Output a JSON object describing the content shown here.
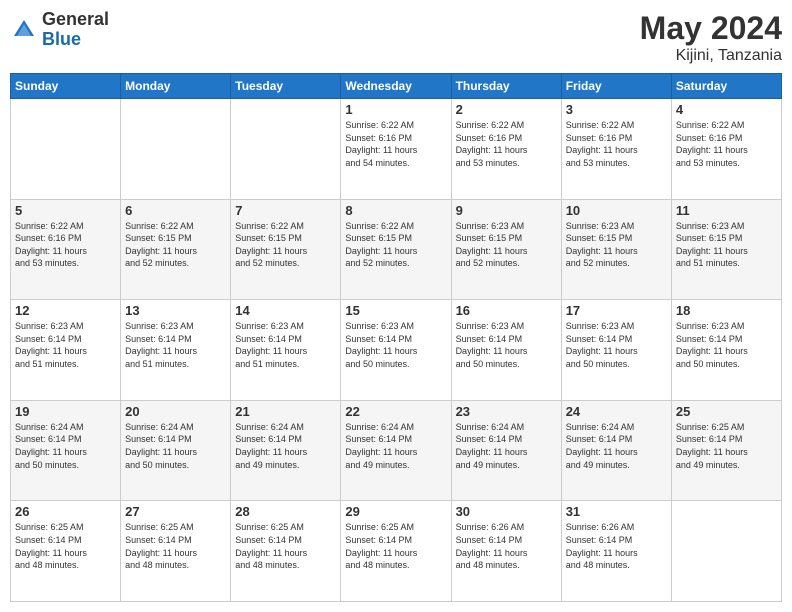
{
  "header": {
    "logo": {
      "general": "General",
      "blue": "Blue"
    },
    "title": "May 2024",
    "subtitle": "Kijini, Tanzania"
  },
  "days_of_week": [
    "Sunday",
    "Monday",
    "Tuesday",
    "Wednesday",
    "Thursday",
    "Friday",
    "Saturday"
  ],
  "weeks": [
    [
      {
        "day": "",
        "info": ""
      },
      {
        "day": "",
        "info": ""
      },
      {
        "day": "",
        "info": ""
      },
      {
        "day": "1",
        "info": "Sunrise: 6:22 AM\nSunset: 6:16 PM\nDaylight: 11 hours\nand 54 minutes."
      },
      {
        "day": "2",
        "info": "Sunrise: 6:22 AM\nSunset: 6:16 PM\nDaylight: 11 hours\nand 53 minutes."
      },
      {
        "day": "3",
        "info": "Sunrise: 6:22 AM\nSunset: 6:16 PM\nDaylight: 11 hours\nand 53 minutes."
      },
      {
        "day": "4",
        "info": "Sunrise: 6:22 AM\nSunset: 6:16 PM\nDaylight: 11 hours\nand 53 minutes."
      }
    ],
    [
      {
        "day": "5",
        "info": "Sunrise: 6:22 AM\nSunset: 6:16 PM\nDaylight: 11 hours\nand 53 minutes."
      },
      {
        "day": "6",
        "info": "Sunrise: 6:22 AM\nSunset: 6:15 PM\nDaylight: 11 hours\nand 52 minutes."
      },
      {
        "day": "7",
        "info": "Sunrise: 6:22 AM\nSunset: 6:15 PM\nDaylight: 11 hours\nand 52 minutes."
      },
      {
        "day": "8",
        "info": "Sunrise: 6:22 AM\nSunset: 6:15 PM\nDaylight: 11 hours\nand 52 minutes."
      },
      {
        "day": "9",
        "info": "Sunrise: 6:23 AM\nSunset: 6:15 PM\nDaylight: 11 hours\nand 52 minutes."
      },
      {
        "day": "10",
        "info": "Sunrise: 6:23 AM\nSunset: 6:15 PM\nDaylight: 11 hours\nand 52 minutes."
      },
      {
        "day": "11",
        "info": "Sunrise: 6:23 AM\nSunset: 6:15 PM\nDaylight: 11 hours\nand 51 minutes."
      }
    ],
    [
      {
        "day": "12",
        "info": "Sunrise: 6:23 AM\nSunset: 6:14 PM\nDaylight: 11 hours\nand 51 minutes."
      },
      {
        "day": "13",
        "info": "Sunrise: 6:23 AM\nSunset: 6:14 PM\nDaylight: 11 hours\nand 51 minutes."
      },
      {
        "day": "14",
        "info": "Sunrise: 6:23 AM\nSunset: 6:14 PM\nDaylight: 11 hours\nand 51 minutes."
      },
      {
        "day": "15",
        "info": "Sunrise: 6:23 AM\nSunset: 6:14 PM\nDaylight: 11 hours\nand 50 minutes."
      },
      {
        "day": "16",
        "info": "Sunrise: 6:23 AM\nSunset: 6:14 PM\nDaylight: 11 hours\nand 50 minutes."
      },
      {
        "day": "17",
        "info": "Sunrise: 6:23 AM\nSunset: 6:14 PM\nDaylight: 11 hours\nand 50 minutes."
      },
      {
        "day": "18",
        "info": "Sunrise: 6:23 AM\nSunset: 6:14 PM\nDaylight: 11 hours\nand 50 minutes."
      }
    ],
    [
      {
        "day": "19",
        "info": "Sunrise: 6:24 AM\nSunset: 6:14 PM\nDaylight: 11 hours\nand 50 minutes."
      },
      {
        "day": "20",
        "info": "Sunrise: 6:24 AM\nSunset: 6:14 PM\nDaylight: 11 hours\nand 50 minutes."
      },
      {
        "day": "21",
        "info": "Sunrise: 6:24 AM\nSunset: 6:14 PM\nDaylight: 11 hours\nand 49 minutes."
      },
      {
        "day": "22",
        "info": "Sunrise: 6:24 AM\nSunset: 6:14 PM\nDaylight: 11 hours\nand 49 minutes."
      },
      {
        "day": "23",
        "info": "Sunrise: 6:24 AM\nSunset: 6:14 PM\nDaylight: 11 hours\nand 49 minutes."
      },
      {
        "day": "24",
        "info": "Sunrise: 6:24 AM\nSunset: 6:14 PM\nDaylight: 11 hours\nand 49 minutes."
      },
      {
        "day": "25",
        "info": "Sunrise: 6:25 AM\nSunset: 6:14 PM\nDaylight: 11 hours\nand 49 minutes."
      }
    ],
    [
      {
        "day": "26",
        "info": "Sunrise: 6:25 AM\nSunset: 6:14 PM\nDaylight: 11 hours\nand 48 minutes."
      },
      {
        "day": "27",
        "info": "Sunrise: 6:25 AM\nSunset: 6:14 PM\nDaylight: 11 hours\nand 48 minutes."
      },
      {
        "day": "28",
        "info": "Sunrise: 6:25 AM\nSunset: 6:14 PM\nDaylight: 11 hours\nand 48 minutes."
      },
      {
        "day": "29",
        "info": "Sunrise: 6:25 AM\nSunset: 6:14 PM\nDaylight: 11 hours\nand 48 minutes."
      },
      {
        "day": "30",
        "info": "Sunrise: 6:26 AM\nSunset: 6:14 PM\nDaylight: 11 hours\nand 48 minutes."
      },
      {
        "day": "31",
        "info": "Sunrise: 6:26 AM\nSunset: 6:14 PM\nDaylight: 11 hours\nand 48 minutes."
      },
      {
        "day": "",
        "info": ""
      }
    ]
  ]
}
